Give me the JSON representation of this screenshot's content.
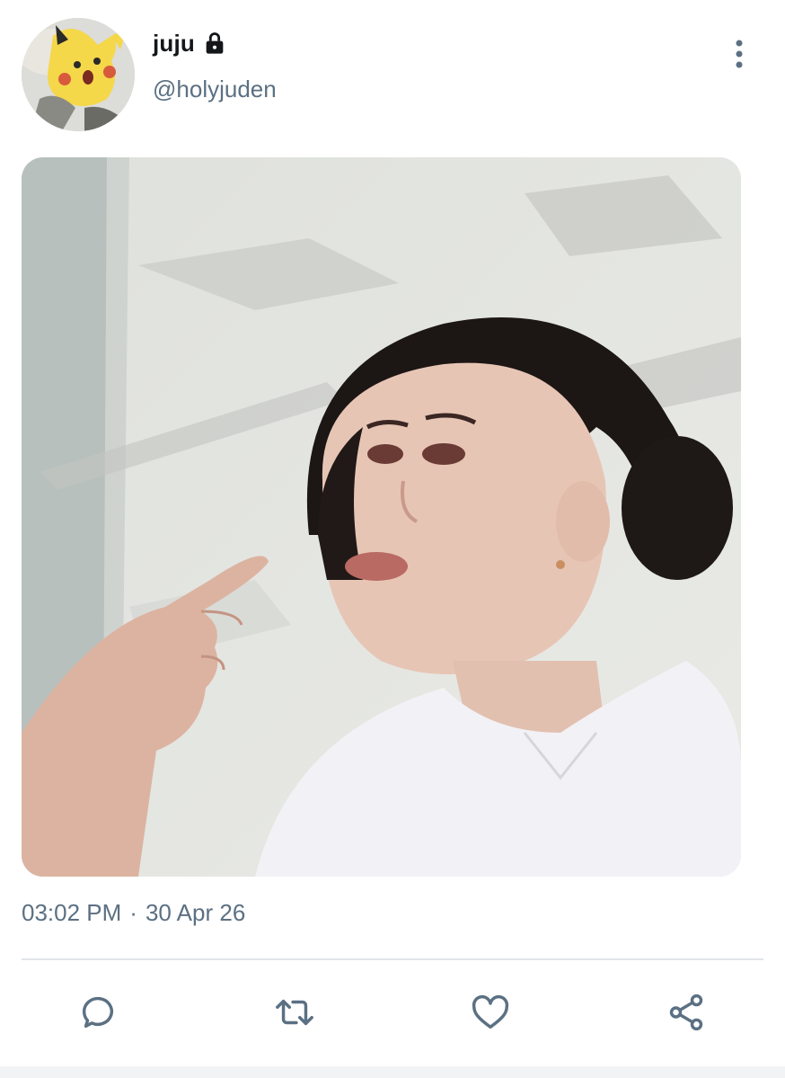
{
  "user": {
    "display_name": "juju",
    "handle": "@holyjuden",
    "protected_icon": "lock-icon",
    "avatar_icon": "pikachu-avatar"
  },
  "menu": {
    "icon": "more-vertical-icon"
  },
  "media": {
    "description_icon": "photo"
  },
  "meta": {
    "time": "03:02 PM",
    "separator": "·",
    "date": "30 Apr 26"
  },
  "actions": [
    {
      "name": "reply",
      "icon": "reply-icon"
    },
    {
      "name": "retweet",
      "icon": "retweet-icon"
    },
    {
      "name": "like",
      "icon": "heart-icon"
    },
    {
      "name": "share",
      "icon": "share-icon"
    }
  ],
  "colors": {
    "text_primary": "#14171a",
    "text_secondary": "#5b7083",
    "divider": "#e1e5e9"
  }
}
